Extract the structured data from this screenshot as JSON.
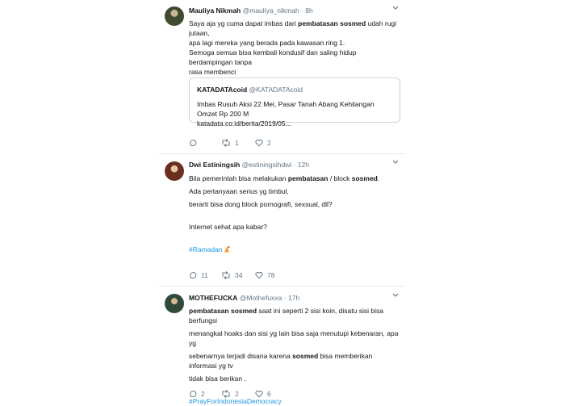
{
  "tweets": [
    {
      "name": "Mauliya Nikmah",
      "handle": "@mauliya_nikmah",
      "time": "8h",
      "lines": [
        {
          "pre": "Saya aja yg cuma dapat imbas dari ",
          "bold": "pembatasan sosmed",
          "post": " udah rugi jutaan,"
        },
        {
          "text": "apa lagi mereka yang berada pada kawasan ring 1."
        },
        {
          "text": "Semoga semua bisa kembali kondusif dan saling hidup berdampingan tanpa"
        },
        {
          "text": "rasa membenci"
        }
      ],
      "quote": {
        "name": "KATADATAcoid",
        "handle": "@KATADATAcoid",
        "line1": "Imbas Rusuh Aksi 22 Mei, Pasar Tanah Abang Kehilangan Omzet Rp 200 M",
        "line2": "katadata.co.id/berita/2019/05..."
      },
      "actions": {
        "reply": "",
        "retweet": "1",
        "like": "2"
      }
    },
    {
      "name": "Dwi Estiningsih",
      "handle": "@estiningsihdwi",
      "time": "12h",
      "lines": [
        {
          "pre": "Bila pemerintah bisa melakukan ",
          "bold": "pembatasan",
          "mid": " / block ",
          "bold2": "sosmed",
          "post": "."
        },
        {
          "text": "Ada pertanyaan serius yg timbul,"
        },
        {
          "text": "berarti bisa dong block pornografi, sexsual, dll?"
        },
        {
          "text": "Internet sehat apa kabar?"
        }
      ],
      "hashtag": "#Ramadan",
      "actions": {
        "reply": "11",
        "retweet": "34",
        "like": "78"
      }
    },
    {
      "name": "MOTHEFUCKA",
      "handle": "@Mothefuxxa",
      "time": "17h",
      "lines": [
        {
          "pre": "",
          "bold": "pembatasan sosmed",
          "post": " saat ini seperti 2 sisi koin, disatu sisi bisa berfungsi"
        },
        {
          "text": "menangkal hoaks dan sisi yg lain bisa saja menutupi kebenaran, apa yg"
        },
        {
          "pre": "sebenarnya terjadi disana karena ",
          "bold": "sosmed",
          "post": " bisa memberikan informasi yg tv"
        },
        {
          "text": "tidak bisa berikan ."
        }
      ],
      "hashtag": "#PrayForIndonesiaDemocracy",
      "actions": {
        "reply": "2",
        "retweet": "2",
        "like": "6"
      }
    }
  ],
  "sep": "·"
}
